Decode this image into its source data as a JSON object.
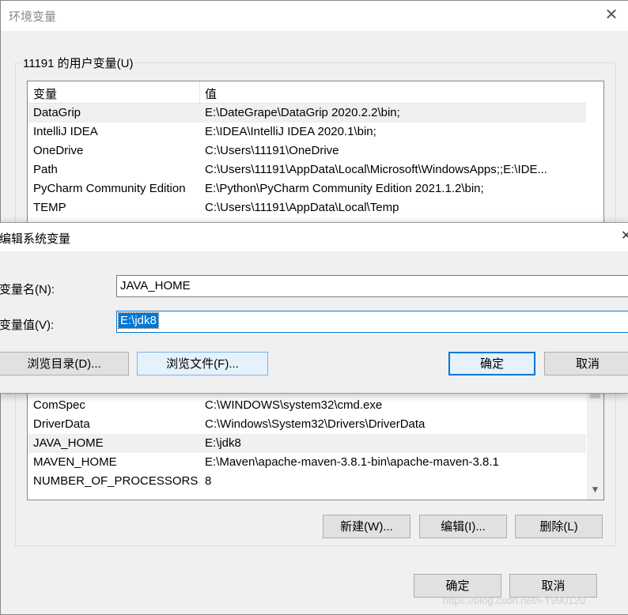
{
  "env_window": {
    "title": "环境变量",
    "user_group_label": "11191 的用户变量(U)",
    "columns": [
      "变量",
      "值"
    ],
    "user_variables": [
      {
        "name": "DataGrip",
        "value": "E:\\DateGrape\\DataGrip 2020.2.2\\bin;"
      },
      {
        "name": "IntelliJ IDEA",
        "value": "E:\\IDEA\\IntelliJ IDEA 2020.1\\bin;"
      },
      {
        "name": "OneDrive",
        "value": "C:\\Users\\11191\\OneDrive"
      },
      {
        "name": "Path",
        "value": "C:\\Users\\11191\\AppData\\Local\\Microsoft\\WindowsApps;;E:\\IDE..."
      },
      {
        "name": "PyCharm Community Edition",
        "value": "E:\\Python\\PyCharm Community Edition 2021.1.2\\bin;"
      },
      {
        "name": "TEMP",
        "value": "C:\\Users\\11191\\AppData\\Local\\Temp"
      }
    ],
    "system_variables": [
      {
        "name": "ComSpec",
        "value": "C:\\WINDOWS\\system32\\cmd.exe"
      },
      {
        "name": "DriverData",
        "value": "C:\\Windows\\System32\\Drivers\\DriverData"
      },
      {
        "name": "JAVA_HOME",
        "value": "E:\\jdk8"
      },
      {
        "name": "MAVEN_HOME",
        "value": "E:\\Maven\\apache-maven-3.8.1-bin\\apache-maven-3.8.1"
      },
      {
        "name": "NUMBER_OF_PROCESSORS",
        "value": "8"
      }
    ],
    "new_button": "新建(W)...",
    "edit_button": "编辑(I)...",
    "delete_button": "删除(L)",
    "ok_button": "确定",
    "cancel_button": "取消"
  },
  "edit_dialog": {
    "title": "编辑系统变量",
    "name_label": "变量名(N):",
    "value_label": "变量值(V):",
    "name_value": "JAVA_HOME",
    "value_value": "E:\\jdk8",
    "browse_dir_button": "浏览目录(D)...",
    "browse_file_button": "浏览文件(F)...",
    "ok_button": "确定",
    "cancel_button": "取消"
  },
  "watermark": "https://blog.csdn.net/FY990120"
}
